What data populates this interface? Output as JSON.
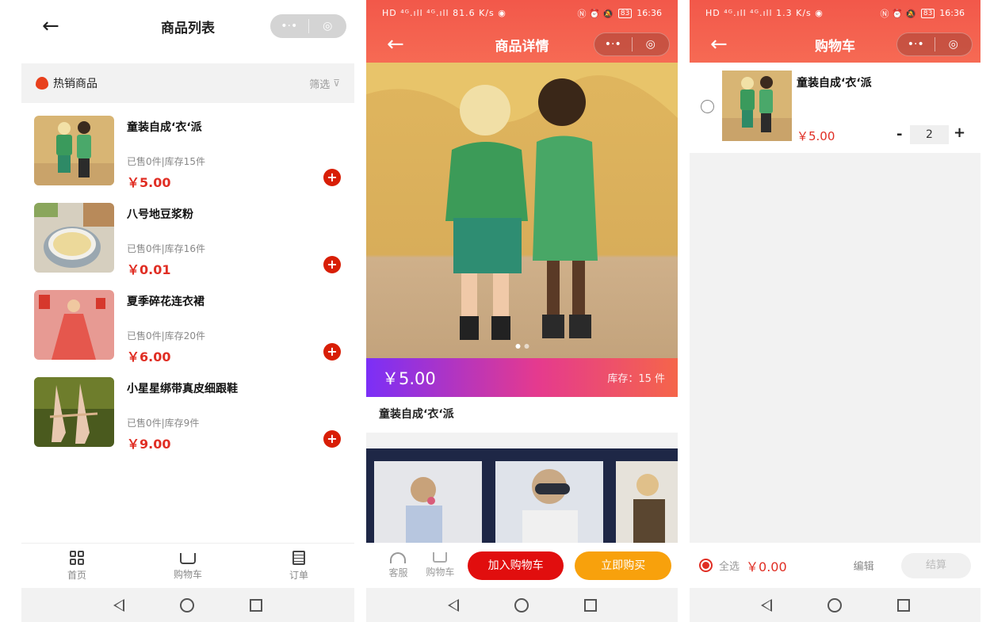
{
  "list_page": {
    "title": "商品列表",
    "hot_label": "热销商品",
    "filter_label": "筛选",
    "products": [
      {
        "name": "童装自成‘衣‘派",
        "sold": "已售0件|库存15件",
        "price": "￥5.00"
      },
      {
        "name": "八号地豆浆粉",
        "sold": "已售0件|库存16件",
        "price": "￥0.01"
      },
      {
        "name": "夏季碎花连衣裙",
        "sold": "已售0件|库存20件",
        "price": "￥6.00"
      },
      {
        "name": "小星星绑带真皮细跟鞋",
        "sold": "已售0件|库存9件",
        "price": "￥9.00"
      }
    ],
    "tabs": [
      {
        "label": "首页"
      },
      {
        "label": "购物车"
      },
      {
        "label": "订单"
      }
    ]
  },
  "detail_page": {
    "status": {
      "left": "HD ⁴ᴳ.ıll ⁴ᴳ.ıll 81.6 K/s ◉",
      "time": "16:36",
      "battery": "83"
    },
    "title": "商品详情",
    "price": "￥5.00",
    "stock": "库存：15 件",
    "name": "童装自成‘衣‘派",
    "service_label": "客服",
    "cart_label": "购物车",
    "add_cart_label": "加入购物车",
    "buy_now_label": "立即购买"
  },
  "cart_page": {
    "status": {
      "left": "HD ⁴ᴳ.ıll ⁴ᴳ.ıll 1.3 K/s ◉",
      "time": "16:36",
      "battery": "83"
    },
    "title": "购物车",
    "item": {
      "name": "童装自成‘衣‘派",
      "price": "￥5.00",
      "qty": "2"
    },
    "minus": "-",
    "plus": "+",
    "select_all": "全选",
    "total": "￥0.00",
    "edit": "编辑",
    "checkout": "结算"
  },
  "colors": {
    "accent_red": "#e02e24",
    "header_red": "#f2584a",
    "buy_orange": "#f8a10c"
  }
}
